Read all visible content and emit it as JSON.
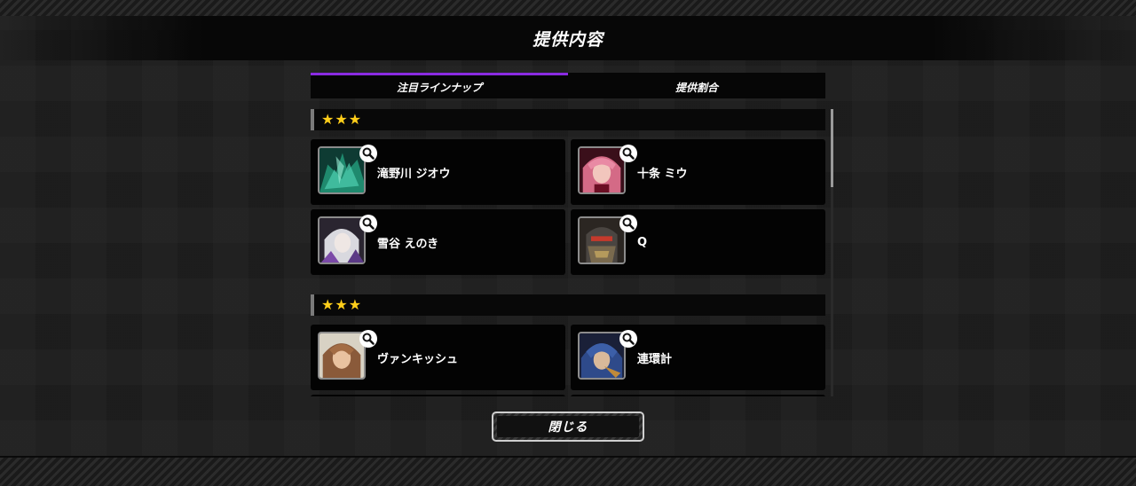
{
  "dialog": {
    "title": "提供内容",
    "tabs": [
      {
        "label": "注目ラインナップ",
        "active": true
      },
      {
        "label": "提供割合",
        "active": false
      }
    ],
    "close_label": "閉じる"
  },
  "sections": [
    {
      "stars": "★★★",
      "rarity": 3,
      "items": [
        {
          "name": "滝野川 ジオウ",
          "portrait": "green-armored-character-portrait"
        },
        {
          "name": "十条 ミウ",
          "portrait": "pink-haired-character-portrait"
        },
        {
          "name": "雪谷 えのき",
          "portrait": "white-haired-character-portrait"
        },
        {
          "name": "Q",
          "portrait": "dark-armored-character-portrait"
        }
      ]
    },
    {
      "stars": "★★★",
      "rarity": 3,
      "items": [
        {
          "name": "ヴァンキッシュ",
          "portrait": "brown-haired-character-portrait"
        },
        {
          "name": "連環計",
          "portrait": "blue-haired-character-portrait"
        }
      ]
    }
  ],
  "colors": {
    "tab_accent": "#8a2be2",
    "star": "#ffce1a",
    "card_bg": "#030303"
  }
}
